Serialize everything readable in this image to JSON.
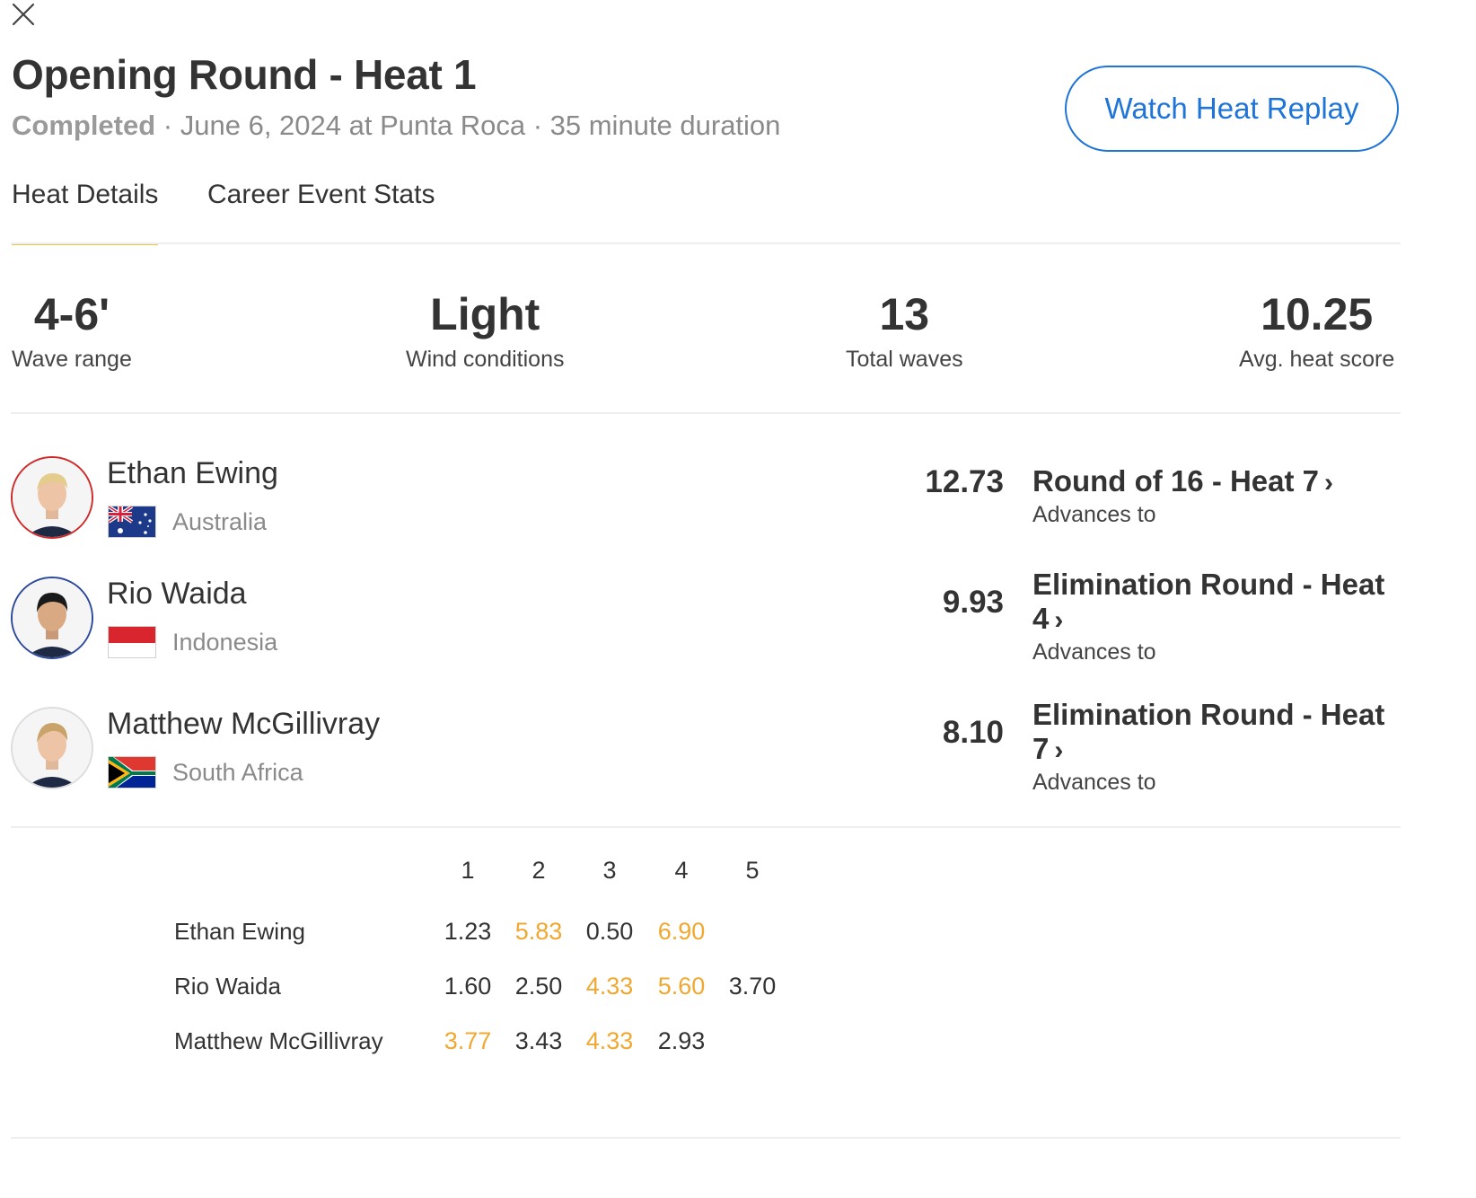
{
  "header": {
    "title": "Opening Round - Heat 1",
    "status": "Completed",
    "separator": " · ",
    "details": "June 6, 2024 at Punta Roca · 35 minute duration",
    "replay_button": "Watch Heat Replay"
  },
  "tabs": [
    {
      "label": "Heat Details",
      "active": true
    },
    {
      "label": "Career Event Stats",
      "active": false
    }
  ],
  "stats": [
    {
      "value": "4-6'",
      "label": "Wave range"
    },
    {
      "value": "Light",
      "label": "Wind conditions"
    },
    {
      "value": "13",
      "label": "Total waves"
    },
    {
      "value": "10.25",
      "label": "Avg. heat score"
    }
  ],
  "athletes": [
    {
      "name": "Ethan Ewing",
      "country": "Australia",
      "score": "12.73",
      "next_heat": "Round of 16 - Heat 7",
      "advance_label": "Advances to",
      "ring_color": "#cf2a2a"
    },
    {
      "name": "Rio Waida",
      "country": "Indonesia",
      "score": "9.93",
      "next_heat": "Elimination Round - Heat 4",
      "advance_label": "Advances to",
      "ring_color": "#2d4a9a"
    },
    {
      "name": "Matthew McGillivray",
      "country": "South Africa",
      "score": "8.10",
      "next_heat": "Elimination Round - Heat 7",
      "advance_label": "Advances to",
      "ring_color": "#dddddd"
    }
  ],
  "waves": {
    "columns": [
      "1",
      "2",
      "3",
      "4",
      "5"
    ],
    "highlight_color": "#f0a830",
    "rows": [
      {
        "name": "Ethan Ewing",
        "scores": [
          {
            "value": "1.23",
            "counted": false
          },
          {
            "value": "5.83",
            "counted": true
          },
          {
            "value": "0.50",
            "counted": false
          },
          {
            "value": "6.90",
            "counted": true
          }
        ]
      },
      {
        "name": "Rio Waida",
        "scores": [
          {
            "value": "1.60",
            "counted": false
          },
          {
            "value": "2.50",
            "counted": false
          },
          {
            "value": "4.33",
            "counted": true
          },
          {
            "value": "5.60",
            "counted": true
          },
          {
            "value": "3.70",
            "counted": false
          }
        ]
      },
      {
        "name": "Matthew McGillivray",
        "scores": [
          {
            "value": "3.77",
            "counted": true
          },
          {
            "value": "3.43",
            "counted": false
          },
          {
            "value": "4.33",
            "counted": true
          },
          {
            "value": "2.93",
            "counted": false
          }
        ]
      }
    ]
  }
}
